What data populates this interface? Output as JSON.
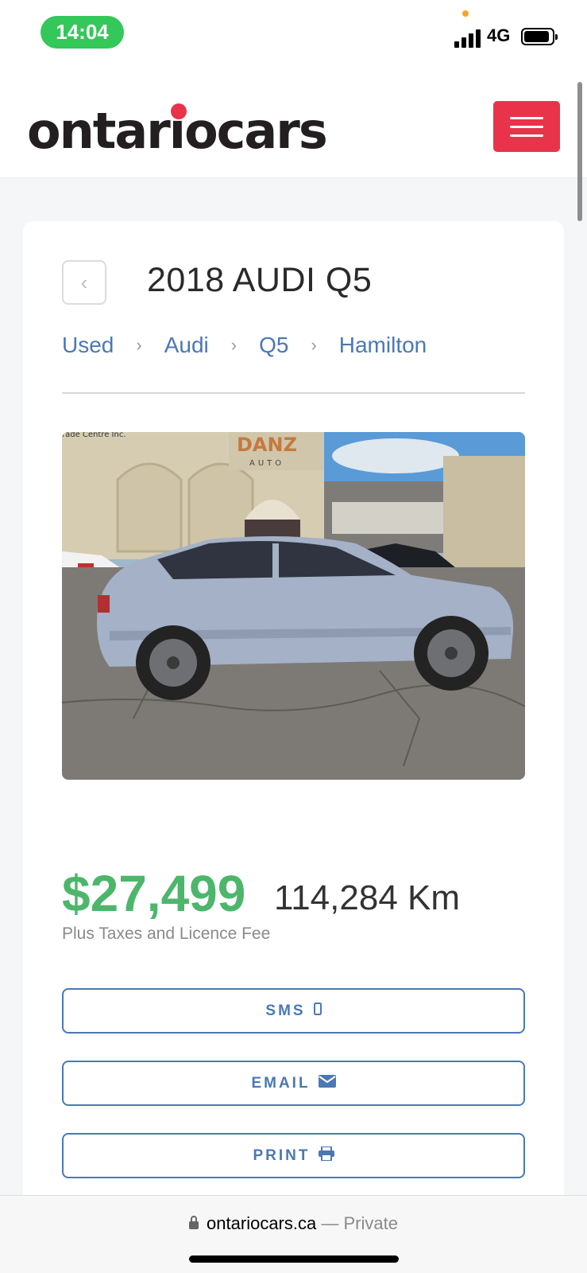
{
  "status_bar": {
    "time": "14:04",
    "network": "4G"
  },
  "header": {
    "logo_text_1": "ontar",
    "logo_text_2": "ocars",
    "menu_icon": "hamburger-icon",
    "accent_color": "#e8334a"
  },
  "listing": {
    "back_icon": "chevron-left-icon",
    "title": "2018 AUDI Q5",
    "breadcrumb": [
      "Used",
      "Audi",
      "Q5",
      "Hamilton"
    ],
    "breadcrumb_separator": "›",
    "photo_alt": "Silver 2018 Audi Q5 parked in front of Danz Auto",
    "sign_text": "DANZ",
    "sign_subtext": "AUTO",
    "building_text": "rade Centre Inc.",
    "price": "$27,499",
    "mileage": "114,284 Km",
    "price_note": "Plus Taxes and Licence Fee",
    "price_color": "#4db66b",
    "actions": [
      {
        "label": "SMS",
        "icon": "mobile-icon"
      },
      {
        "label": "EMAIL",
        "icon": "envelope-icon"
      },
      {
        "label": "PRINT",
        "icon": "printer-icon"
      }
    ]
  },
  "browser": {
    "domain": "ontariocars.ca",
    "mode": "— Private"
  }
}
